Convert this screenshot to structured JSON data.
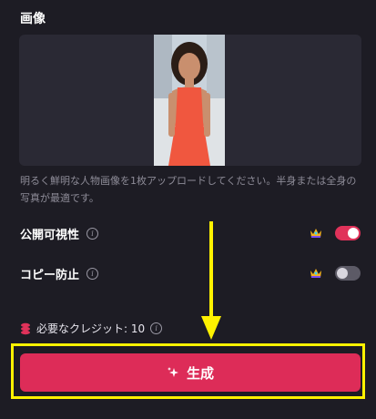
{
  "image_section": {
    "title": "画像",
    "hint": "明るく鮮明な人物画像を1枚アップロードしてください。半身または全身の写真が最適です。"
  },
  "options": [
    {
      "label": "公開可視性",
      "enabled": true,
      "premium": true
    },
    {
      "label": "コピー防止",
      "enabled": false,
      "premium": true
    }
  ],
  "credits": {
    "text": "必要なクレジット: 10"
  },
  "generate": {
    "label": "生成"
  },
  "colors": {
    "accent": "#dd2c58",
    "highlight": "#fff200",
    "background": "#1d1c24"
  },
  "icons": [
    "info-icon",
    "crown-icon",
    "coin-stack-icon",
    "sparkle-icon",
    "arrow-down-icon"
  ]
}
